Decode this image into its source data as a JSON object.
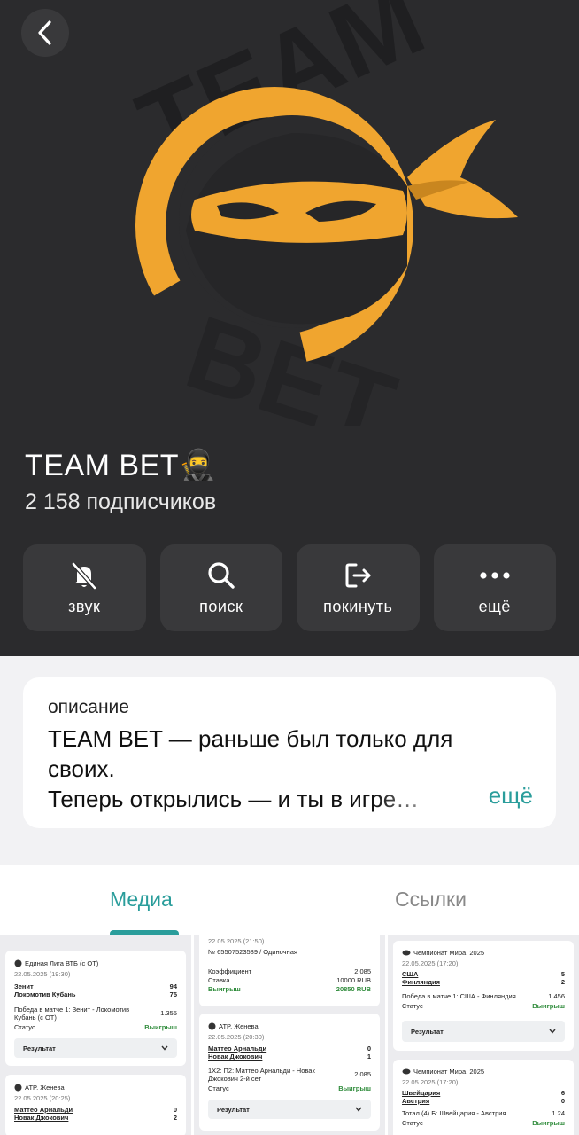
{
  "header": {
    "back_icon": "chevron-left-icon",
    "channel_name": "TEAM BET🥷",
    "subscribers": "2 158 подписчиков",
    "logo": {
      "top_text": "TEAM",
      "bottom_text": "BET",
      "accent": "#f0a52f"
    }
  },
  "actions": [
    {
      "icon": "bell-off-icon",
      "label": "звук"
    },
    {
      "icon": "search-icon",
      "label": "поиск"
    },
    {
      "icon": "leave-icon",
      "label": "покинуть"
    },
    {
      "icon": "more-icon",
      "label": "ещё"
    }
  ],
  "description": {
    "heading": "описание",
    "text_line1": "TEAM BET — раньше был только для",
    "text_line2": "своих.",
    "text_line3": "Теперь открылись — и ты в игре…",
    "more": "ещё"
  },
  "tabs": {
    "media": "Медиа",
    "links": "Ссылки",
    "active": "media",
    "accent": "#2a9d9b"
  },
  "media": {
    "col1": {
      "card1": {
        "league": "Единая Лига ВТБ (с ОТ)",
        "datetime": "22.05.2025 (19:30)",
        "team1": "Зенит",
        "score1": "94",
        "team2": "Локомотив Кубань",
        "score2": "75",
        "bet_line1": "Победа в матче 1: Зенит - Локомотив",
        "bet_line2": "Кубань (с ОТ)",
        "odds": "1.355",
        "status_label": "Статус",
        "status": "Выигрыш",
        "button": "Результат"
      },
      "card2": {
        "league": "ATP. Женева",
        "datetime": "22.05.2025 (20:25)",
        "team1": "Маттео Арнальди",
        "score1": "0",
        "team2": "Новак Джокович",
        "score2": "2"
      }
    },
    "col2": {
      "card1": {
        "datetime": "22.05.2025 (21:50)",
        "ticket": "№ 65507523589 / Одиночная",
        "coef_label": "Коэффициент",
        "coef": "2.085",
        "stake_label": "Ставка",
        "stake": "10000 RUB",
        "status": "Выигрыш",
        "payout": "20850 RUB"
      },
      "card2": {
        "league": "ATP. Женева",
        "datetime": "22.05.2025 (20:30)",
        "team1": "Маттео Арнальди",
        "score1": "0",
        "team2": "Новак Джокович",
        "score2": "1",
        "bet_line1": "1X2: П2: Маттео Арнальди - Новак",
        "bet_line2": "Джокович 2-й сет",
        "odds": "2.085",
        "status_label": "Статус",
        "status": "Выигрыш",
        "button": "Результат"
      }
    },
    "col3": {
      "card1": {
        "league": "Чемпионат Мира. 2025",
        "datetime": "22.05.2025 (17:20)",
        "team1": "США",
        "score1": "5",
        "team2": "Финляндия",
        "score2": "2",
        "bet_line1": "Победа в матче 1: США - Финляндия",
        "odds": "1.456",
        "status_label": "Статус",
        "status": "Выигрыш",
        "button": "Результат"
      },
      "card2": {
        "league": "Чемпионат Мира. 2025",
        "datetime": "22.05.2025 (17:20)",
        "team1": "Швейцария",
        "score1": "6",
        "team2": "Австрия",
        "score2": "0",
        "bet_line1": "Тотал (4) Б: Швейцария - Австрия",
        "odds": "1.24",
        "status_label": "Статус",
        "status": "Выигрыш"
      }
    }
  }
}
